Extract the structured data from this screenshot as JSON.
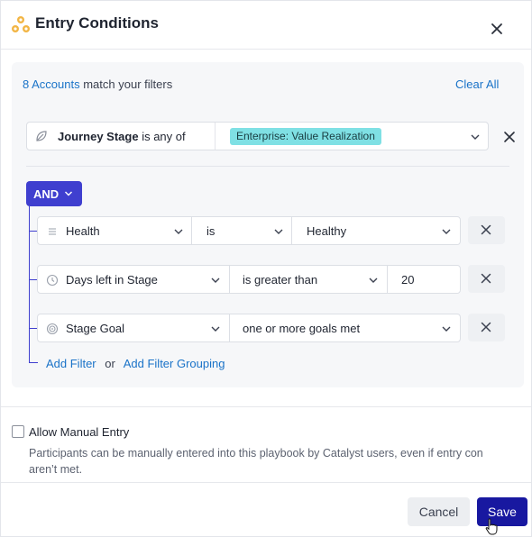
{
  "header": {
    "title": "Entry Conditions",
    "logo_icon": "playbook-logo-icon",
    "close_icon": "close-icon"
  },
  "summary": {
    "count_link": "8 Accounts",
    "suffix": " match your filters",
    "clear_all": "Clear All"
  },
  "stage_filter": {
    "icon": "leaf-icon",
    "field": "Journey Stage",
    "operator": " is any of",
    "value_tag": "Enterprise: Value Realization"
  },
  "group": {
    "operator": "AND",
    "filters": [
      {
        "icon": "list-icon",
        "field": "Health",
        "operator": "is",
        "value": "Healthy"
      },
      {
        "icon": "clock-icon",
        "field": "Days left in Stage",
        "operator": "is greater than",
        "value": "20"
      },
      {
        "icon": "target-icon",
        "field": "Stage Goal",
        "operator": "one or more goals met",
        "value": ""
      }
    ],
    "add_filter": "Add Filter",
    "or_text": "or",
    "add_group": "Add Filter Grouping"
  },
  "manual_entry": {
    "checked": false,
    "label": "Allow Manual Entry",
    "desc_line1": "Participants can be manually entered into this playbook by Catalyst users, even if entry con",
    "desc_line2": "aren’t met."
  },
  "footer": {
    "cancel": "Cancel",
    "save": "Save"
  },
  "colors": {
    "accent": "#3f3fcf",
    "link": "#1a73c8",
    "tag": "#7fe0e4",
    "save": "#1818a0"
  }
}
